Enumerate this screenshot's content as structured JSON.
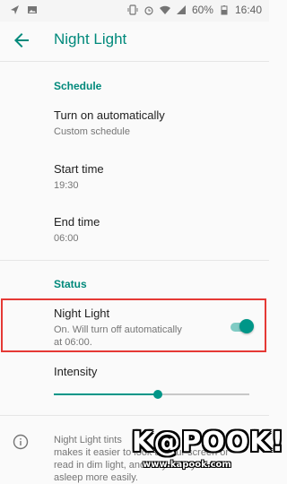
{
  "status_bar": {
    "battery": "60%",
    "time": "16:40",
    "icons": [
      "navigation-icon",
      "image-icon",
      "vibrate-icon",
      "alarm-icon",
      "wifi-icon",
      "signal-icon",
      "battery-icon"
    ]
  },
  "toolbar": {
    "title": "Night Light",
    "back_icon": "arrow-back-icon"
  },
  "schedule": {
    "header": "Schedule",
    "turn_on": {
      "title": "Turn on automatically",
      "value": "Custom schedule"
    },
    "start": {
      "title": "Start time",
      "value": "19:30"
    },
    "end": {
      "title": "End time",
      "value": "06:00"
    }
  },
  "status": {
    "header": "Status",
    "night_light": {
      "title": "Night Light",
      "summary_line1": "On. Will turn off automatically",
      "summary_line2": "at 06:00.",
      "enabled": true
    },
    "intensity": {
      "label": "Intensity",
      "value": 0.53
    }
  },
  "footer": {
    "info_icon": "info-icon",
    "line1": "Night Light tints",
    "line2": "makes it easier to look at your screen or",
    "line3": "read in dim light, and may help you fall",
    "line4": "asleep more easily."
  },
  "watermark": {
    "main": "K@POOK!",
    "sub": "www.kapook.com"
  },
  "colors": {
    "accent": "#00897b",
    "toggle_thumb": "#009688",
    "highlight_border": "#e53935"
  }
}
